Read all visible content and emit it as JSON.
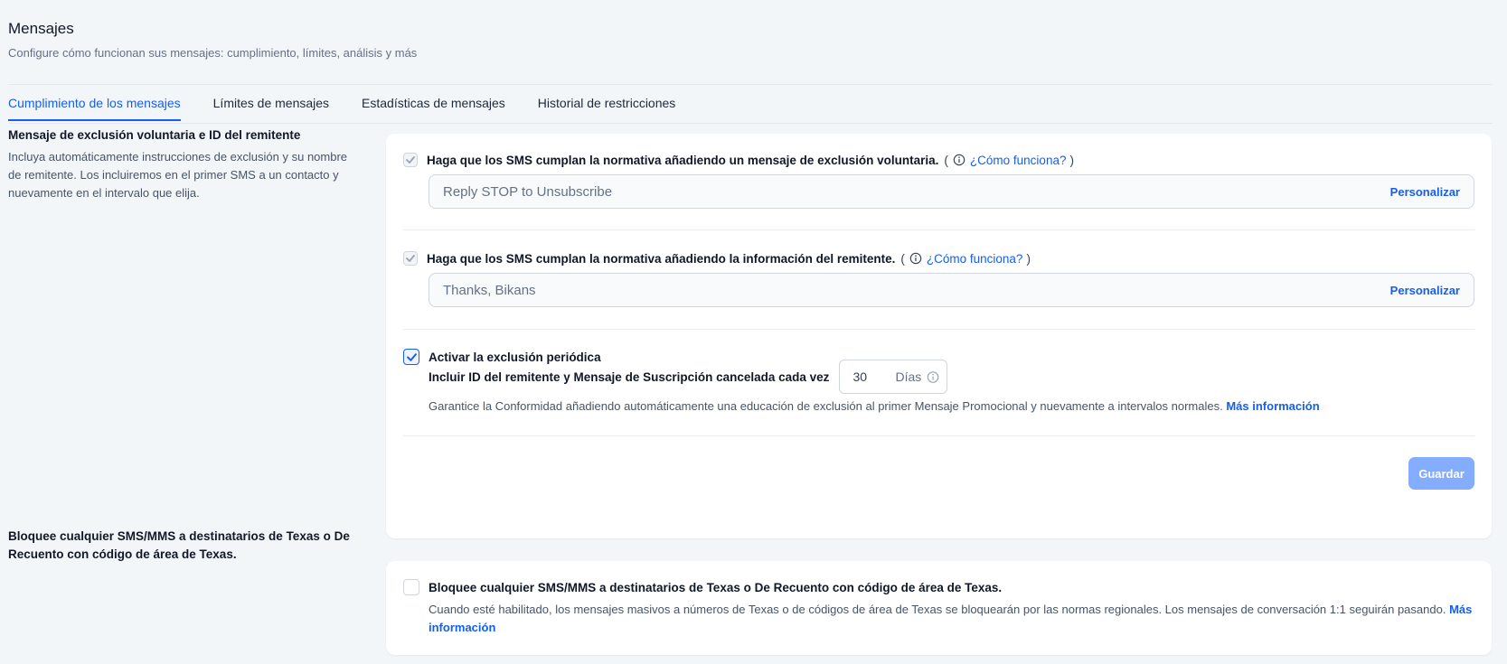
{
  "page": {
    "title": "Mensajes",
    "subtitle": "Configure cómo funcionan sus mensajes: cumplimiento, límites, análisis y más"
  },
  "tabs": [
    {
      "label": "Cumplimiento de los mensajes",
      "active": true
    },
    {
      "label": "Límites de mensajes",
      "active": false
    },
    {
      "label": "Estadísticas de mensajes",
      "active": false
    },
    {
      "label": "Historial de restricciones",
      "active": false
    }
  ],
  "section1": {
    "title": "Mensaje de exclusión voluntaria e ID del remitente",
    "description": "Incluya automáticamente instrucciones de exclusión y su nombre de remitente. Los incluiremos en el primer SMS a un contacto y nuevamente en el intervalo que elija.",
    "optout": {
      "label": "Haga que los SMS cumplan la normativa añadiendo un mensaje de exclusión voluntaria.",
      "checked": true,
      "disabled": true,
      "paren_open": "(",
      "paren_close": ")",
      "how_link": "¿Cómo funciona?",
      "value": "Reply STOP to Unsubscribe",
      "action": "Personalizar"
    },
    "sender": {
      "label": "Haga que los SMS cumplan la normativa añadiendo la información del remitente.",
      "checked": true,
      "disabled": true,
      "paren_open": "(",
      "paren_close": ")",
      "how_link": "¿Cómo funciona?",
      "value": "Thanks, Bikans",
      "action": "Personalizar"
    },
    "periodic": {
      "label": "Activar la exclusión periódica",
      "checked": true,
      "interval_label": "Incluir ID del remitente y Mensaje de Suscripción cancelada cada vez",
      "interval_value": "30",
      "interval_unit": "Días",
      "help": "Garantice la Conformidad añadiendo automáticamente una educación de exclusión al primer Mensaje Promocional y nuevamente a intervalos normales.",
      "more_link": "Más información"
    },
    "save_label": "Guardar"
  },
  "section2": {
    "title": "Bloquee cualquier SMS/MMS a destinatarios de Texas o De Recuento con código de área de Texas.",
    "checkbox_label": "Bloquee cualquier SMS/MMS a destinatarios de Texas o De Recuento con código de área de Texas.",
    "checked": false,
    "help": "Cuando esté habilitado, los mensajes masivos a números de Texas o de códigos de área de Texas se bloquearán por las normas regionales. Los mensajes de conversación 1:1 seguirán pasando.",
    "more_link": "Más información"
  },
  "colors": {
    "accent": "#155eef",
    "save_button": "#84adff",
    "background": "#f3f6f9"
  }
}
